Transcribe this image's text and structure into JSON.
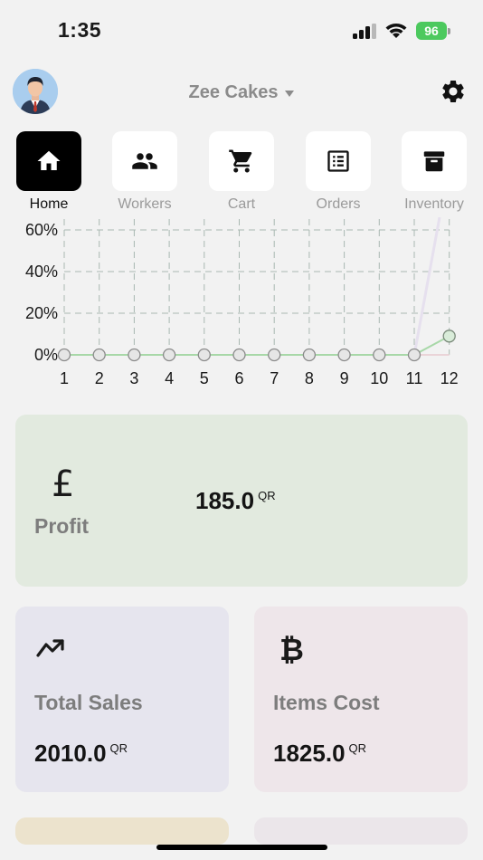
{
  "status_bar": {
    "time": "1:35",
    "battery": "96"
  },
  "header": {
    "shop_name": "Zee Cakes"
  },
  "nav": [
    {
      "label": "Home",
      "icon": "home-icon",
      "active": true
    },
    {
      "label": "Workers",
      "icon": "workers-icon",
      "active": false
    },
    {
      "label": "Cart",
      "icon": "cart-icon",
      "active": false
    },
    {
      "label": "Orders",
      "icon": "orders-icon",
      "active": false
    },
    {
      "label": "Inventory",
      "icon": "inventory-icon",
      "active": false
    }
  ],
  "chart_data": {
    "type": "line",
    "x": [
      1,
      2,
      3,
      4,
      5,
      6,
      7,
      8,
      9,
      10,
      11,
      12
    ],
    "xticks": [
      "1",
      "2",
      "3",
      "4",
      "5",
      "6",
      "7",
      "8",
      "9",
      "10",
      "11",
      "12"
    ],
    "yticks": [
      "0%",
      "20%",
      "40%",
      "60%"
    ],
    "ylim": [
      0,
      60
    ],
    "series": [
      {
        "values": [
          0,
          0,
          0,
          0,
          0,
          0,
          0,
          0,
          0,
          0,
          0,
          9
        ],
        "color": "#a8d8a8"
      }
    ],
    "grid": true
  },
  "cards": {
    "profit": {
      "title": "Profit",
      "amount": "185.0",
      "unit": "QR"
    },
    "total_sales": {
      "title": "Total Sales",
      "amount": "2010.0",
      "unit": "QR"
    },
    "items_cost": {
      "title": "Items Cost",
      "amount": "1825.0",
      "unit": "QR"
    }
  },
  "icons": {
    "profit": "£",
    "items_cost": "₿"
  }
}
